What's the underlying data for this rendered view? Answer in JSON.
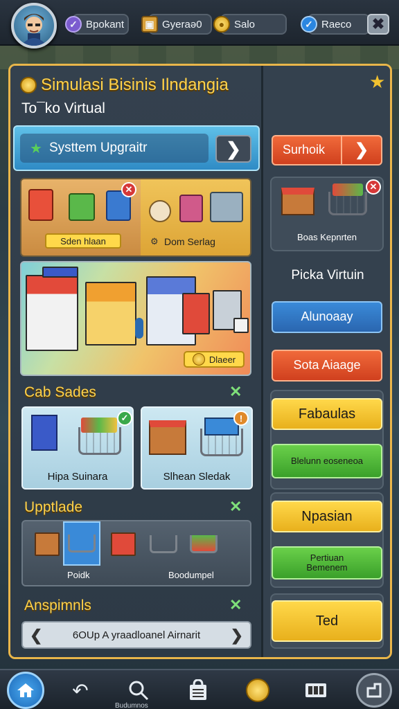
{
  "topbar": {
    "stats": [
      {
        "icon": "check-badge-icon",
        "label": "Bpokant",
        "color": "#7b5ccf"
      },
      {
        "icon": "crate-icon",
        "label": "Gyeraə0",
        "color": "#d9a13a"
      },
      {
        "icon": "gold-coin-icon",
        "label": "Salo",
        "color": "#e0a81c"
      },
      {
        "icon": "blue-check-icon",
        "label": "Raeco",
        "color": "#2b86e0"
      }
    ],
    "close_symbol": "✖"
  },
  "main": {
    "title": "Simulasi Bisinis Ilndangia",
    "subtitle": "To¯ko Virtual",
    "upgrade_banner": {
      "label": "Systtem Upgraitr",
      "star": "★",
      "arrow": "❯"
    },
    "shop_panel": {
      "left_label": "Sden hlaan",
      "right_label": "Dom Serlag",
      "right_marker": "⚙"
    },
    "city_panel": {
      "button_label": "Dlaeer"
    },
    "cash_section": {
      "title": "Cab Sades",
      "close": "✕",
      "cards": [
        {
          "caption": "Hipa Suinara"
        },
        {
          "caption": "Slhean Sledak"
        }
      ]
    },
    "upgrade_section": {
      "title": "Upptlade",
      "close": "✕",
      "items": [
        {
          "caption": "Poidk"
        },
        {
          "caption": "Boodumpel"
        }
      ]
    },
    "achievements_section": {
      "title": "Anspimnls",
      "close": "✕",
      "bar_text": "6OUp A yraadloanel Airnarit",
      "prev": "❮",
      "next": "❯"
    }
  },
  "sidebar": {
    "surhoik": {
      "label": "Surhoik",
      "arrow": "❯"
    },
    "store_card": {
      "caption": "Boas Kepnrten"
    },
    "section_title": "Picka Virtuin",
    "buttons": [
      {
        "label": "Alunoaay",
        "color": "#2f7fc4"
      },
      {
        "label": "Sota Aiaage",
        "color": "#e0542a"
      },
      {
        "label": "Fabaulas",
        "color": "#f2c230"
      },
      {
        "label": "Blelunn eoseneoa",
        "color": "#5cbf3a"
      },
      {
        "label": "Npasian",
        "color": "#f2c230"
      },
      {
        "label": "Pertiuan Bemenem",
        "color": "#5cbf3a"
      },
      {
        "label": "Ted",
        "color": "#f2c230"
      }
    ]
  },
  "bottom_nav": {
    "items": [
      {
        "icon": "home-icon"
      },
      {
        "icon": "back-arrow-icon"
      },
      {
        "icon": "search-icon"
      },
      {
        "icon": "shopping-bag-icon"
      },
      {
        "icon": "coin-rocket-icon"
      },
      {
        "icon": "film-icon"
      },
      {
        "icon": "exit-icon"
      }
    ],
    "small_label": "Budumnos"
  }
}
